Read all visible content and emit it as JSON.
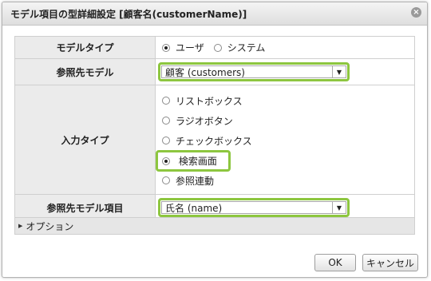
{
  "dialog": {
    "title": "モデル項目の型詳細設定 [顧客名(customerName)]",
    "close_glyph": "⊗"
  },
  "form": {
    "model_type": {
      "label": "モデルタイプ",
      "options": [
        "ユーザ",
        "システム"
      ],
      "selected": "ユーザ"
    },
    "ref_model": {
      "label": "参照先モデル",
      "value": "顧客 (customers)"
    },
    "input_type": {
      "label": "入力タイプ",
      "options": [
        "リストボックス",
        "ラジオボタン",
        "チェックボックス",
        "検索画面",
        "参照連動"
      ],
      "selected": "検索画面"
    },
    "ref_model_item": {
      "label": "参照先モデル項目",
      "value": "氏名 (name)"
    }
  },
  "options_section": {
    "label": "オプション"
  },
  "buttons": {
    "ok": "OK",
    "cancel": "キャンセル"
  },
  "colors": {
    "highlight": "#8dc63f",
    "label_bg": "#ebebeb"
  }
}
